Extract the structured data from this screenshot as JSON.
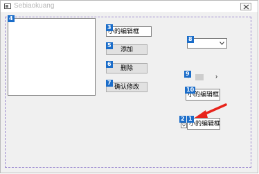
{
  "window": {
    "title": "Sebiaokuang",
    "close_icon": "close-icon",
    "app_icon": "window-icon"
  },
  "controls": {
    "tag_1": "1",
    "tag_2": "2",
    "tag_3": "3",
    "tag_4": "4",
    "tag_5": "5",
    "tag_6": "6",
    "tag_7": "7",
    "tag_8": "8",
    "tag_9": "9",
    "tag_10": "10",
    "textbox_3": "小的编辑框",
    "button_add": "添加",
    "button_delete": "删除",
    "button_confirm_edit": "确认修改",
    "textbox_10": "小的编辑框",
    "textbox_1": "小的编辑框",
    "scroll_left": "‹",
    "scroll_right": "›"
  },
  "colors": {
    "tag_blue": "#1b6dc9",
    "guide_purple": "#9c8ad0",
    "pointer_red": "#e8241b"
  }
}
